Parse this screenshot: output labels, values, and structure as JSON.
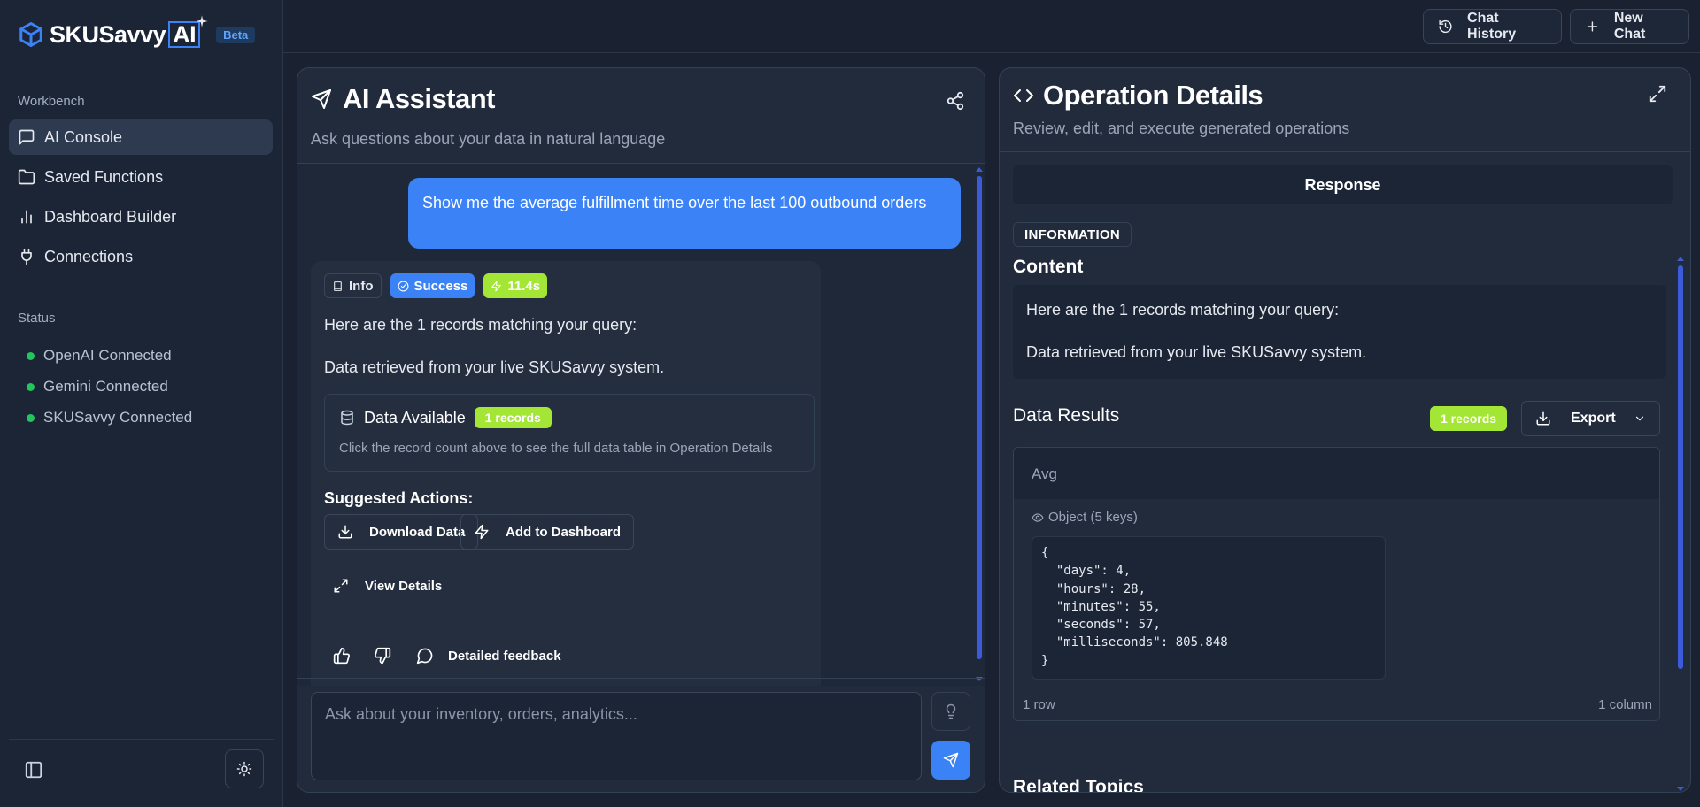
{
  "brand": {
    "name": "SKUSavvy",
    "ai": "AI",
    "badge": "Beta"
  },
  "sidebar": {
    "workbench_label": "Workbench",
    "nav": [
      {
        "label": "AI Console",
        "icon": "chat-bubble-icon",
        "active": true
      },
      {
        "label": "Saved Functions",
        "icon": "folder-icon",
        "active": false
      },
      {
        "label": "Dashboard Builder",
        "icon": "bar-chart-icon",
        "active": false
      },
      {
        "label": "Connections",
        "icon": "plug-icon",
        "active": false
      }
    ],
    "status_label": "Status",
    "status": [
      {
        "label": "OpenAI Connected",
        "color": "#22c55e"
      },
      {
        "label": "Gemini Connected",
        "color": "#22c55e"
      },
      {
        "label": "SKUSavvy Connected",
        "color": "#22c55e"
      }
    ]
  },
  "topbar": {
    "history_label": "Chat History",
    "new_chat_label": "New Chat"
  },
  "chat": {
    "title": "AI Assistant",
    "subtitle": "Ask questions about your data in natural language",
    "user_message": "Show me the average fulfillment time over the last 100 outbound orders",
    "badges": {
      "info": "Info",
      "success": "Success",
      "time": "11.4s"
    },
    "response_line1": "Here are the 1 records matching your query:",
    "response_line2": "Data retrieved from your live SKUSavvy system.",
    "data_available": "Data Available",
    "records_badge": "1 records",
    "data_note": "Click the record count above to see the full data table in Operation Details",
    "suggested_label": "Suggested Actions:",
    "actions": {
      "download": "Download Data",
      "dashboard": "Add to Dashboard",
      "view": "View Details"
    },
    "feedback_label": "Detailed feedback",
    "input_placeholder": "Ask about your inventory, orders, analytics..."
  },
  "ops": {
    "title": "Operation Details",
    "subtitle": "Review, edit, and execute generated operations",
    "tab_response": "Response",
    "info_tag": "INFORMATION",
    "content_heading": "Content",
    "content_line1": "Here are the 1 records matching your query:",
    "content_line2": "Data retrieved from your live SKUSavvy system.",
    "results_heading": "Data Results",
    "records_badge": "1 records",
    "export_label": "Export",
    "column_header": "Avg",
    "object_label": "Object (5 keys)",
    "json_text": "{\n  \"days\": 4,\n  \"hours\": 28,\n  \"minutes\": 55,\n  \"seconds\": 57,\n  \"milliseconds\": 805.848\n}",
    "row_count": "1 row",
    "column_count": "1 column",
    "related_heading": "Related Topics"
  },
  "colors": {
    "accent": "#3b82f6",
    "lime": "#a3e635",
    "status_green": "#22c55e",
    "background": "#1a2231"
  }
}
